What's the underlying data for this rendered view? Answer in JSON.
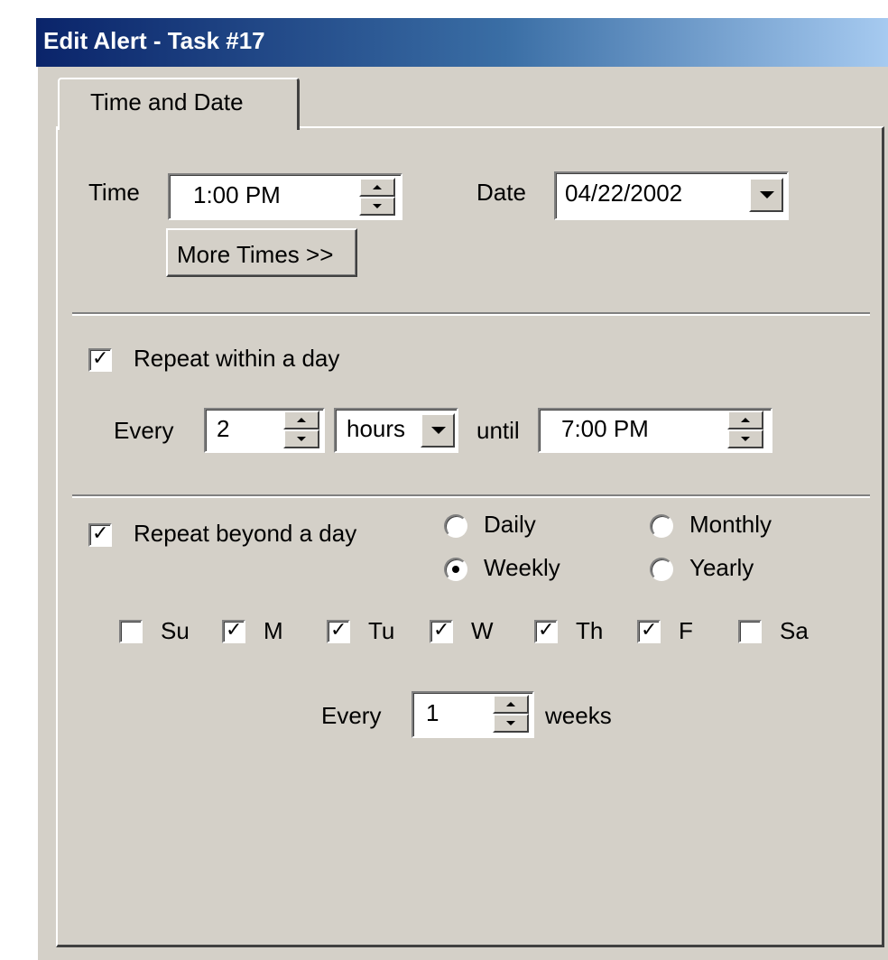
{
  "window": {
    "title": "Edit Alert - Task #17"
  },
  "tabs": [
    {
      "label": "Time and Date",
      "selected": true
    }
  ],
  "time_section": {
    "time_label": "Time",
    "time_value": "1:00 PM",
    "date_label": "Date",
    "date_value": "04/22/2002",
    "more_times_button": "More Times >>"
  },
  "repeat_within_day": {
    "label": "Repeat within a day",
    "checked": true,
    "every_label": "Every",
    "interval_value": "2",
    "unit_value": "hours",
    "until_label": "until",
    "until_value": "7:00 PM"
  },
  "repeat_beyond_day": {
    "label": "Repeat beyond a day",
    "checked": true,
    "options": [
      {
        "label": "Daily",
        "selected": false
      },
      {
        "label": "Monthly",
        "selected": false
      },
      {
        "label": "Weekly",
        "selected": true
      },
      {
        "label": "Yearly",
        "selected": false
      }
    ],
    "days": [
      {
        "label": "Su",
        "checked": false
      },
      {
        "label": "M",
        "checked": true
      },
      {
        "label": "Tu",
        "checked": true
      },
      {
        "label": "W",
        "checked": true
      },
      {
        "label": "Th",
        "checked": true
      },
      {
        "label": "F",
        "checked": true
      },
      {
        "label": "Sa",
        "checked": false
      }
    ],
    "every_label": "Every",
    "every_value": "1",
    "every_unit": "weeks"
  },
  "colors": {
    "face": "#d4d0c8",
    "title_start": "#0a246a",
    "title_end": "#a6caf0"
  }
}
